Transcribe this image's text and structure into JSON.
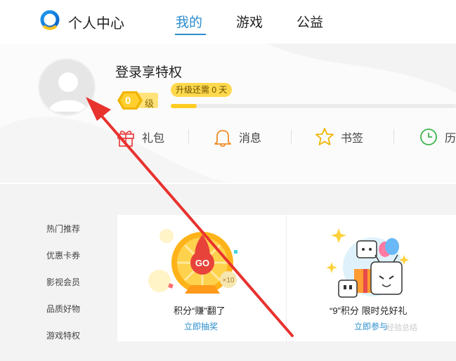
{
  "header": {
    "app_title": "个人中心",
    "tabs": [
      {
        "label": "我的",
        "active": true
      },
      {
        "label": "游戏",
        "active": false
      },
      {
        "label": "公益",
        "active": false
      }
    ]
  },
  "profile": {
    "login_title": "登录享特权",
    "level_number": "0",
    "level_unit": "级",
    "upgrade_tip": "升级还需 0 天",
    "progress_fraction": 0.09
  },
  "quick_actions": [
    {
      "label": "礼包",
      "icon": "gift-icon"
    },
    {
      "label": "消息",
      "icon": "bell-icon"
    },
    {
      "label": "书签",
      "icon": "star-icon"
    },
    {
      "label": "历",
      "icon": "clock-icon"
    }
  ],
  "sidebar": {
    "items": [
      {
        "label": "热门推荐"
      },
      {
        "label": "优惠卡券"
      },
      {
        "label": "影视会员"
      },
      {
        "label": "品质好物"
      },
      {
        "label": "游戏特权"
      }
    ]
  },
  "cards": [
    {
      "title": "积分“赚”翻了",
      "link": "立即抽奖",
      "badge": "GO",
      "multiplier": "×10"
    },
    {
      "title": "“9”积分 限时兑好礼",
      "link": "立即参与"
    }
  ],
  "watermark": "经验总结",
  "colors": {
    "accent": "#2a8ccc",
    "gold": "#ffcc22",
    "annotation_arrow": "#e8322e"
  }
}
